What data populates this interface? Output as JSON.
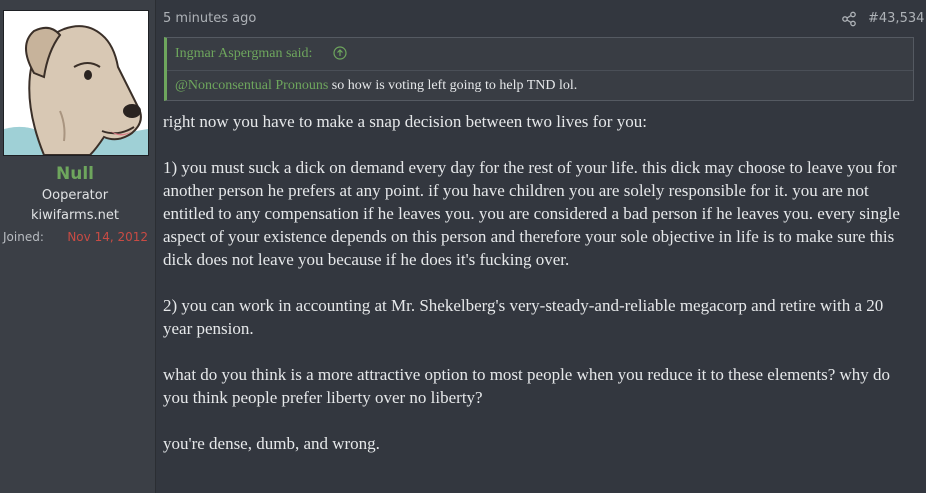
{
  "user": {
    "name": "Null",
    "title": "Ooperator",
    "site": "kiwifarms.net",
    "joined_label": "Joined:",
    "joined_value": "Nov 14, 2012"
  },
  "post": {
    "time": "5 minutes ago",
    "number": "#43,534",
    "share_icon": "share-icon"
  },
  "quote": {
    "author": "Ingmar Aspergman said:",
    "mention": "@Nonconsentual Pronouns",
    "text": " so how is voting left going to help TND lol."
  },
  "body": {
    "paragraphs": [
      "right now you have to make a snap decision between two lives for you:",
      "1) you must suck a dick on demand every day for the rest of your life. this dick may choose to leave you for another person he prefers at any point. if you have children you are solely responsible for it. you are not entitled to any compensation if he leaves you. you are considered a bad person if he leaves you. every single aspect of your existence depends on this person and therefore your sole objective in life is to make sure this dick does not leave you because if he does it's fucking over.",
      "2) you can work in accounting at Mr. Shekelberg's very-steady-and-reliable megacorp and retire with a 20 year pension.",
      "what do you think is a more attractive option to most people when you reduce it to these elements? why do you think people prefer liberty over no liberty?",
      "you're dense, dumb, and wrong."
    ]
  },
  "colors": {
    "accent": "#6ea65d",
    "joined_date": "#c84b44",
    "background": "#33373f",
    "sidebar": "#3b3f46"
  }
}
